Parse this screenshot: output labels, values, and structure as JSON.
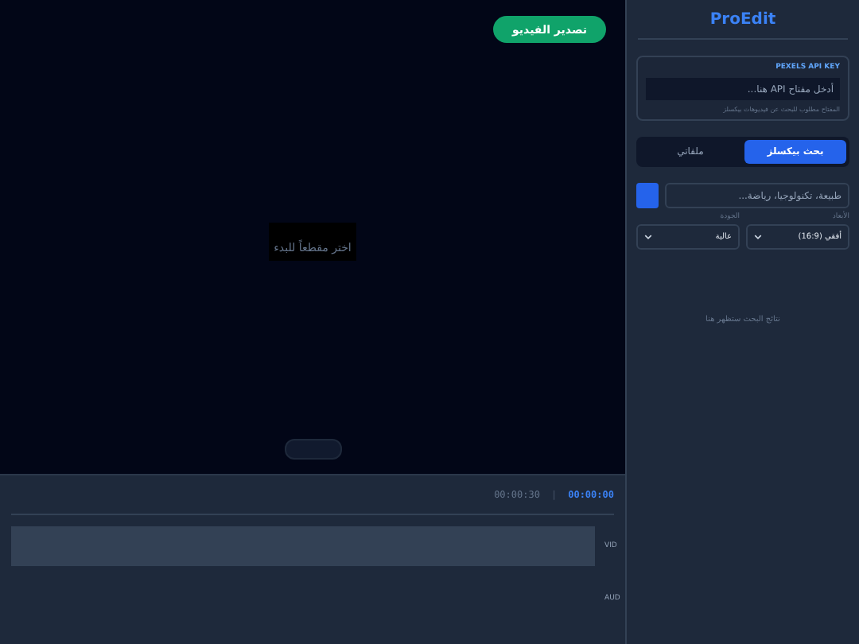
{
  "preview": {
    "export_button": "تصدير الفيديو",
    "placeholder": "اختر مقطعاً للبدء"
  },
  "timeline": {
    "current_time": "00:00:00",
    "separator": "|",
    "total_time": "00:00:30",
    "tracks": [
      {
        "label": "VID",
        "kind": "video"
      },
      {
        "label": "AUD",
        "kind": "audio"
      }
    ]
  },
  "sidebar": {
    "title": "ProEdit",
    "api_key": {
      "label": "PEXELS API KEY",
      "placeholder": "أدخل مفتاح API هنا...",
      "hint": "المفتاح مطلوب للبحث عن فيديوهات بيكسلز"
    },
    "tabs": [
      {
        "label": "بحث بيكسلز",
        "selected": true
      },
      {
        "label": "ملفاتي",
        "selected": false
      }
    ],
    "search": {
      "placeholder": "طبيعة، تكنولوجيا، رياضة..."
    },
    "filters": [
      {
        "label": "الأبعاد",
        "value": "أفقي (16:9)"
      },
      {
        "label": "الجودة",
        "value": "عالية"
      }
    ],
    "empty_message": "نتائج البحث ستظهر هنا"
  }
}
